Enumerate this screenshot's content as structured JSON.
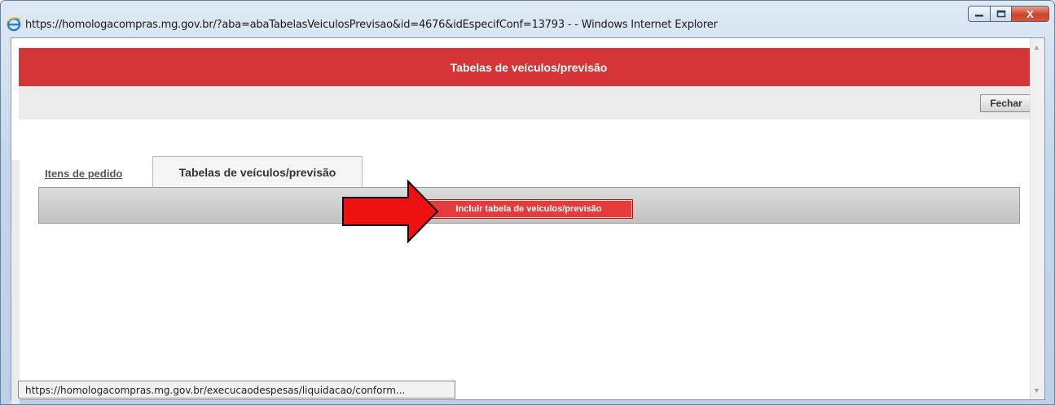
{
  "window": {
    "title": "https://homologacompras.mg.gov.br/?aba=abaTabelasVeiculosPrevisao&id=4676&idEspecifConf=13793 - - Windows Internet Explorer",
    "close_glyph": "X"
  },
  "page": {
    "header_title": "Tabelas de veículos/previsão",
    "close_button": "Fechar",
    "accent_color": "#d63538"
  },
  "tabs": [
    {
      "label": "Itens de pedido",
      "active": false
    },
    {
      "label": "Tabelas de veículos/previsão",
      "active": true
    }
  ],
  "actions": {
    "include_button": "Incluir tabela de veículos/previsão"
  },
  "statusbar": {
    "text": "https://homologacompras.mg.gov.br/execucaodespesas/liquidacao/conform..."
  },
  "icons": [
    "ie-icon",
    "minimize-icon",
    "maximize-icon",
    "close-icon",
    "arrow-pointer-icon",
    "scroll-up-icon",
    "scroll-down-icon"
  ]
}
